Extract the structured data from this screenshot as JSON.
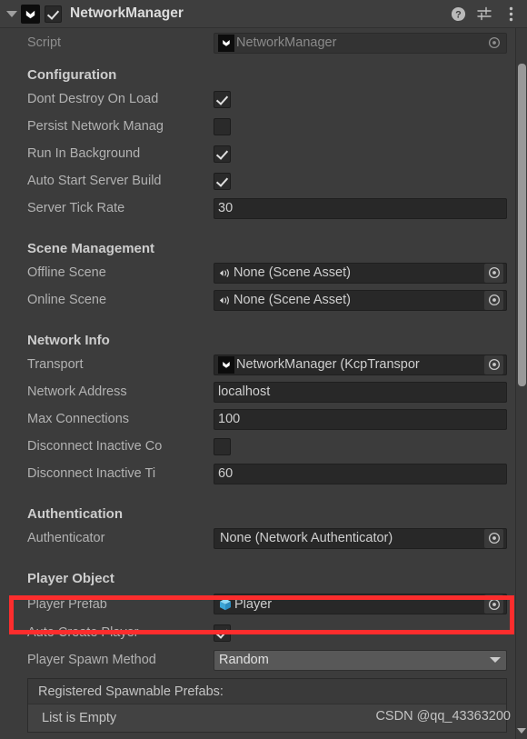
{
  "header": {
    "title": "NetworkManager",
    "enabled": true,
    "foldout_expanded": true,
    "component_icon": "mirror-logo-icon",
    "help_icon": "help-icon",
    "preset_icon": "preset-sliders-icon",
    "menu_icon": "more-vertical-icon"
  },
  "script_row": {
    "label": "Script",
    "value": "NetworkManager",
    "disabled": true
  },
  "sections": {
    "configuration": {
      "title": "Configuration",
      "rows": [
        {
          "label": "Dont Destroy On Load",
          "type": "checkbox",
          "checked": true
        },
        {
          "label": "Persist Network Manag",
          "type": "checkbox",
          "checked": false
        },
        {
          "label": "Run In Background",
          "type": "checkbox",
          "checked": true
        },
        {
          "label": "Auto Start Server Build",
          "type": "checkbox",
          "checked": true
        },
        {
          "label": "Server Tick Rate",
          "type": "number",
          "value": "30"
        }
      ]
    },
    "scene_management": {
      "title": "Scene Management",
      "rows": [
        {
          "label": "Offline Scene",
          "type": "object",
          "value": "None (Scene Asset)",
          "icon": "scene-asset-icon"
        },
        {
          "label": "Online Scene",
          "type": "object",
          "value": "None (Scene Asset)",
          "icon": "scene-asset-icon"
        }
      ]
    },
    "network_info": {
      "title": "Network Info",
      "rows": [
        {
          "label": "Transport",
          "type": "object",
          "value": "NetworkManager (KcpTranspor",
          "icon": "script-asset-icon"
        },
        {
          "label": "Network Address",
          "type": "text",
          "value": "localhost"
        },
        {
          "label": "Max Connections",
          "type": "number",
          "value": "100"
        },
        {
          "label": "Disconnect Inactive Co",
          "type": "checkbox",
          "checked": false
        },
        {
          "label": "Disconnect Inactive Ti",
          "type": "number",
          "value": "60"
        }
      ]
    },
    "authentication": {
      "title": "Authentication",
      "rows": [
        {
          "label": "Authenticator",
          "type": "object",
          "value": "None (Network Authenticator)",
          "icon": "none-icon"
        }
      ]
    },
    "player_object": {
      "title": "Player Object",
      "rows": [
        {
          "label": "Player Prefab",
          "type": "object",
          "value": "Player",
          "icon": "prefab-cube-icon",
          "highlighted": true
        },
        {
          "label": "Auto Create Player",
          "type": "checkbox",
          "checked": true
        },
        {
          "label": "Player Spawn Method",
          "type": "dropdown",
          "value": "Random"
        }
      ],
      "spawnable_list": {
        "header": "Registered Spawnable Prefabs:",
        "empty_text": "List is Empty"
      }
    }
  },
  "scrollbar": {
    "orientation": "vertical",
    "down_arrow_icon": "chevron-down-icon"
  },
  "annotation": {
    "highlight_color": "#fc2d2d",
    "highlight_target": "Player Prefab"
  },
  "watermark": {
    "text": "CSDN @qq_43363200"
  }
}
